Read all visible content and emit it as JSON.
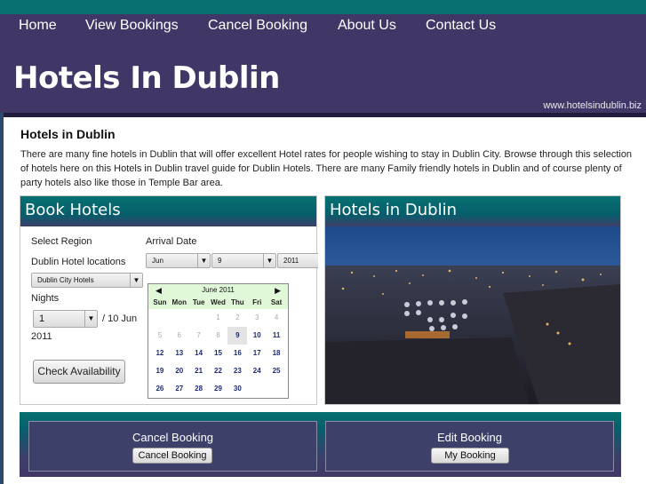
{
  "nav": {
    "items": [
      "Home",
      "View Bookings",
      "Cancel Booking",
      "About Us",
      "Contact Us"
    ]
  },
  "header": {
    "title": "Hotels In Dublin",
    "url": "www.hotelsindublin.biz"
  },
  "main": {
    "heading": "Hotels in Dublin",
    "intro": "There are many fine hotels in Dublin that will offer excellent Hotel rates for people wishing to stay in Dublin City. Browse through this selection of hotels here on this Hotels in Dublin travel guide for Dublin Hotels. There are many Family friendly hotels in Dublin and of course plenty of party hotels also like those in Temple Bar area."
  },
  "book": {
    "title": "Book Hotels",
    "select_region_label": "Select Region",
    "locations_label": "Dublin Hotel locations",
    "location_value": "Dublin City Hotels",
    "nights_label": "Nights",
    "nights_value": "1",
    "checkout_text": "/ 10 Jun",
    "checkout_year": "2011",
    "arrival_label": "Arrival Date",
    "arrival_month": "Jun",
    "arrival_day": "9",
    "arrival_year": "2011",
    "check_button": "Check Availability",
    "calendar": {
      "title": "June 2011",
      "prev_icon": "◀",
      "next_icon": "▶",
      "weekdays": [
        "Sun",
        "Mon",
        "Tue",
        "Wed",
        "Thu",
        "Fri",
        "Sat"
      ],
      "leading_blanks": 3,
      "days": 30,
      "selected_day": 9,
      "past_through": 8
    }
  },
  "photo": {
    "title": "Hotels in Dublin"
  },
  "bottom": {
    "cancel_title": "Cancel Booking",
    "cancel_button": "Cancel Booking",
    "edit_title": "Edit Booking",
    "edit_button": "My Booking"
  }
}
